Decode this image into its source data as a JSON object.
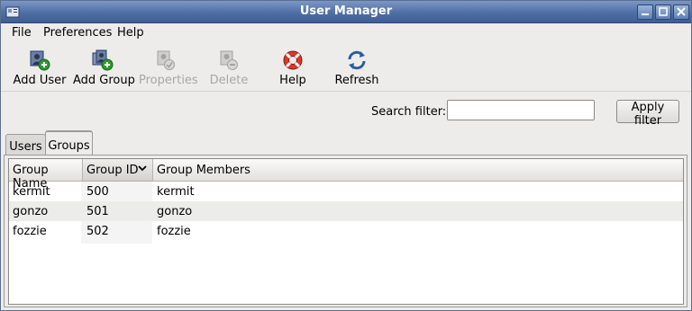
{
  "window": {
    "title": "User Manager"
  },
  "menu": [
    "File",
    "Preferences",
    "Help"
  ],
  "toolbar": {
    "add_user": "Add User",
    "add_group": "Add Group",
    "properties": "Properties",
    "delete": "Delete",
    "help": "Help",
    "refresh": "Refresh"
  },
  "filter": {
    "label": "Search filter:",
    "value": "",
    "apply": "Apply filter"
  },
  "tabs": [
    {
      "label": "Users"
    },
    {
      "label": "Groups"
    }
  ],
  "groups_table": {
    "columns": [
      "Group Name",
      "Group ID",
      "Group Members"
    ],
    "sort_indicator": "⌄",
    "rows": [
      {
        "name": "kermit",
        "id": "500",
        "members": "kermit"
      },
      {
        "name": "gonzo",
        "id": "501",
        "members": "gonzo"
      },
      {
        "name": "fozzie",
        "id": "502",
        "members": "fozzie"
      }
    ]
  }
}
